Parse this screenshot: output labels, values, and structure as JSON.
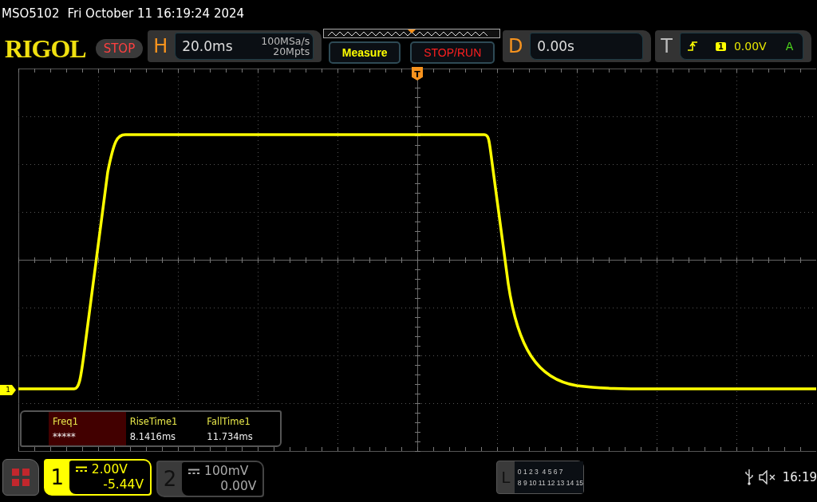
{
  "status_bar": {
    "model": "MSO5102",
    "datetime": "Fri October 11 16:19:24 2024"
  },
  "header": {
    "logo": "RIGOL",
    "run_state": "STOP",
    "horizontal": {
      "label": "H",
      "timebase": "20.0ms",
      "sample_rate": "100MSa/s",
      "memory_depth": "20Mpts"
    },
    "buttons": [
      {
        "label": "Measure",
        "kind": "menu"
      },
      {
        "label": "STOP/RUN",
        "kind": "action"
      }
    ],
    "delay": {
      "label": "D",
      "value": "0.00s"
    },
    "trigger": {
      "label": "T",
      "source": "1",
      "level": "0.00V",
      "mode": "A"
    }
  },
  "trigger_marker": "T",
  "channel_marker": "1",
  "measurements": [
    {
      "name": "Freq1",
      "value": "*****",
      "selected": true
    },
    {
      "name": "RiseTime1",
      "value": "8.1416ms",
      "selected": false
    },
    {
      "name": "FallTime1",
      "value": "11.734ms",
      "selected": false
    }
  ],
  "channels": [
    {
      "number": "1",
      "scale": "2.00V",
      "offset": "-5.44V",
      "on": true
    },
    {
      "number": "2",
      "scale": "100mV",
      "offset": "0.00V",
      "on": false
    }
  ],
  "logic": {
    "label": "L",
    "row_1": "0 1 2 3  4 5 6 7",
    "row_2": "8 9 10 11 12 13 14 15"
  },
  "clock": "16:19"
}
